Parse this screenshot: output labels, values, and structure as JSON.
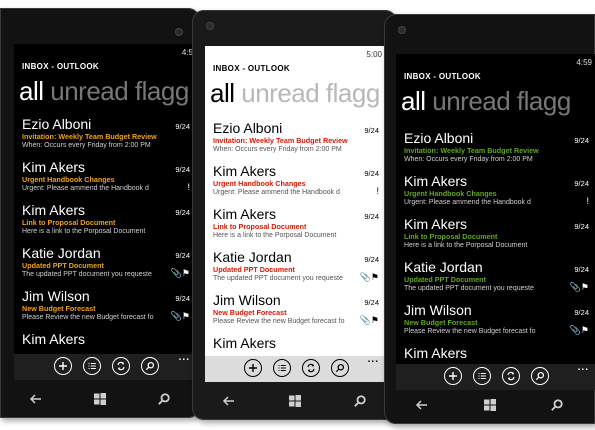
{
  "phones": [
    {
      "theme": "dark",
      "accent": "#f0a30a",
      "clock": "4:5",
      "title": "INBOX - OUTLOOK",
      "pivot_active": "all",
      "pivot_rest": "unread flagg",
      "messages": [
        {
          "sender": "Ezio Alboni",
          "subject": "Invitation: Weekly Team Budget Review",
          "preview": "When: Occurs every Friday from 2:00 PM",
          "date": "9/24",
          "flag": ""
        },
        {
          "sender": "Kim Akers",
          "subject": "Urgent Handbook Changes",
          "preview": "Urgent: Please ammend the Handbook d",
          "date": "9/24",
          "flag": "!"
        },
        {
          "sender": "Kim Akers",
          "subject": "Link to Proposal Document",
          "preview": "Here is a link to the Porposal Document",
          "date": "9/24",
          "flag": ""
        },
        {
          "sender": "Katie Jordan",
          "subject": "Updated PPT Document",
          "preview": "The updated PPT document you requeste",
          "date": "9/24",
          "flag": "📎⚑"
        },
        {
          "sender": "Jim Wilson",
          "subject": "New Budget Forecast",
          "preview": "Please Review the new Budget forecast fo",
          "date": "9/24",
          "flag": "📎⚑"
        },
        {
          "sender": "Kim Akers",
          "subject": "",
          "preview": "",
          "date": "",
          "flag": ""
        }
      ]
    },
    {
      "theme": "light",
      "accent": "#e51400",
      "clock": "5:00",
      "title": "INBOX - OUTLOOK",
      "pivot_active": "all",
      "pivot_rest": "unread flagg",
      "messages": [
        {
          "sender": "Ezio Alboni",
          "subject": "Invitation: Weekly Team Budget Review",
          "preview": "When: Occurs every Friday from 2:00 PM",
          "date": "9/24",
          "flag": ""
        },
        {
          "sender": "Kim Akers",
          "subject": "Urgent Handbook Changes",
          "preview": "Urgent: Please ammend the Handbook d",
          "date": "9/24",
          "flag": "!"
        },
        {
          "sender": "Kim Akers",
          "subject": "Link to Proposal Document",
          "preview": "Here is a link to the Porposal Document",
          "date": "9/24",
          "flag": ""
        },
        {
          "sender": "Katie Jordan",
          "subject": "Updated PPT Document",
          "preview": "The updated PPT document you requeste",
          "date": "9/24",
          "flag": "📎⚑"
        },
        {
          "sender": "Jim Wilson",
          "subject": "New Budget Forecast",
          "preview": "Please Review the new Budget forecast fo",
          "date": "9/24",
          "flag": "📎⚑"
        },
        {
          "sender": "Kim Akers",
          "subject": "",
          "preview": "",
          "date": "",
          "flag": ""
        }
      ]
    },
    {
      "theme": "dark",
      "accent": "#60a917",
      "clock": "4:59",
      "title": "INBOX - OUTLOOK",
      "pivot_active": "all",
      "pivot_rest": "unread flagg",
      "messages": [
        {
          "sender": "Ezio Alboni",
          "subject": "Invitation: Weekly Team Budget Review",
          "preview": "When: Occurs every Friday from 2:00 PM",
          "date": "9/24",
          "flag": ""
        },
        {
          "sender": "Kim Akers",
          "subject": "Urgent Handbook Changes",
          "preview": "Urgent: Please ammend the Handbook d",
          "date": "9/24",
          "flag": "!"
        },
        {
          "sender": "Kim Akers",
          "subject": "Link to Proposal Document",
          "preview": "Here is a link to the Porposal Document",
          "date": "9/24",
          "flag": ""
        },
        {
          "sender": "Katie Jordan",
          "subject": "Updated PPT Document",
          "preview": "The updated PPT document you requeste",
          "date": "9/24",
          "flag": "📎⚑"
        },
        {
          "sender": "Jim Wilson",
          "subject": "New Budget Forecast",
          "preview": "Please Review the new Budget forecast fo",
          "date": "9/24",
          "flag": "📎⚑"
        },
        {
          "sender": "Kim Akers",
          "subject": "",
          "preview": "",
          "date": "",
          "flag": ""
        }
      ]
    }
  ],
  "appbar_buttons": [
    "new-icon",
    "select-icon",
    "sync-icon",
    "search-icon"
  ],
  "appbar_more": "...",
  "nav_buttons": [
    "back-icon",
    "windows-start-icon",
    "search-icon"
  ]
}
